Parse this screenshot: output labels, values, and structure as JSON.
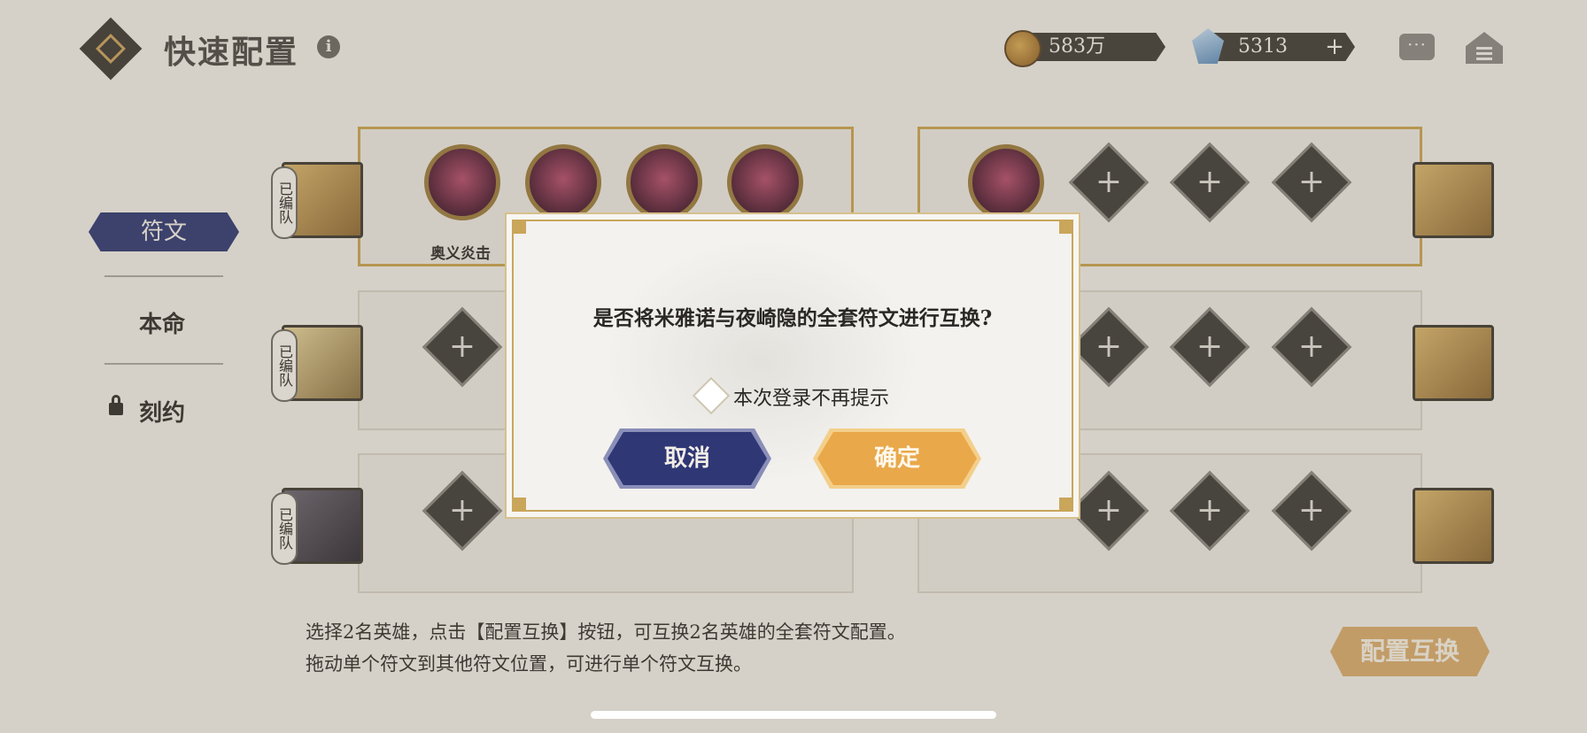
{
  "header": {
    "title": "快速配置",
    "info_icon": "info-icon",
    "gold_amount": "583万",
    "gem_amount": "5313",
    "plus_symbol": "+",
    "chat_icon": "chat-icon",
    "menu_icon": "menu-icon"
  },
  "sidebar": {
    "items": [
      {
        "label": "符文",
        "active": true
      },
      {
        "label": "本命",
        "active": false
      },
      {
        "label": "刻约",
        "active": false,
        "locked": true
      }
    ]
  },
  "rows": [
    {
      "team_badge": "已编队",
      "left_rune_label": "奥义炎击"
    },
    {
      "team_badge": "已编队"
    },
    {
      "team_badge": "已编队"
    }
  ],
  "hints": {
    "line1": "选择2名英雄，点击【配置互换】按钮，可互换2名英雄的全套符文配置。",
    "line2": "拖动单个符文到其他符文位置，可进行单个符文互换。"
  },
  "swap_button": "配置互换",
  "dialog": {
    "question": "是否将米雅诺与夜崎隐的全套符文进行互换?",
    "checkbox_label": "本次登录不再提示",
    "checkbox_checked": false,
    "cancel_label": "取消",
    "confirm_label": "确定"
  },
  "colors": {
    "navy": "#2f3775",
    "gold": "#e9a84a",
    "frame_gold": "#c9a65a"
  }
}
